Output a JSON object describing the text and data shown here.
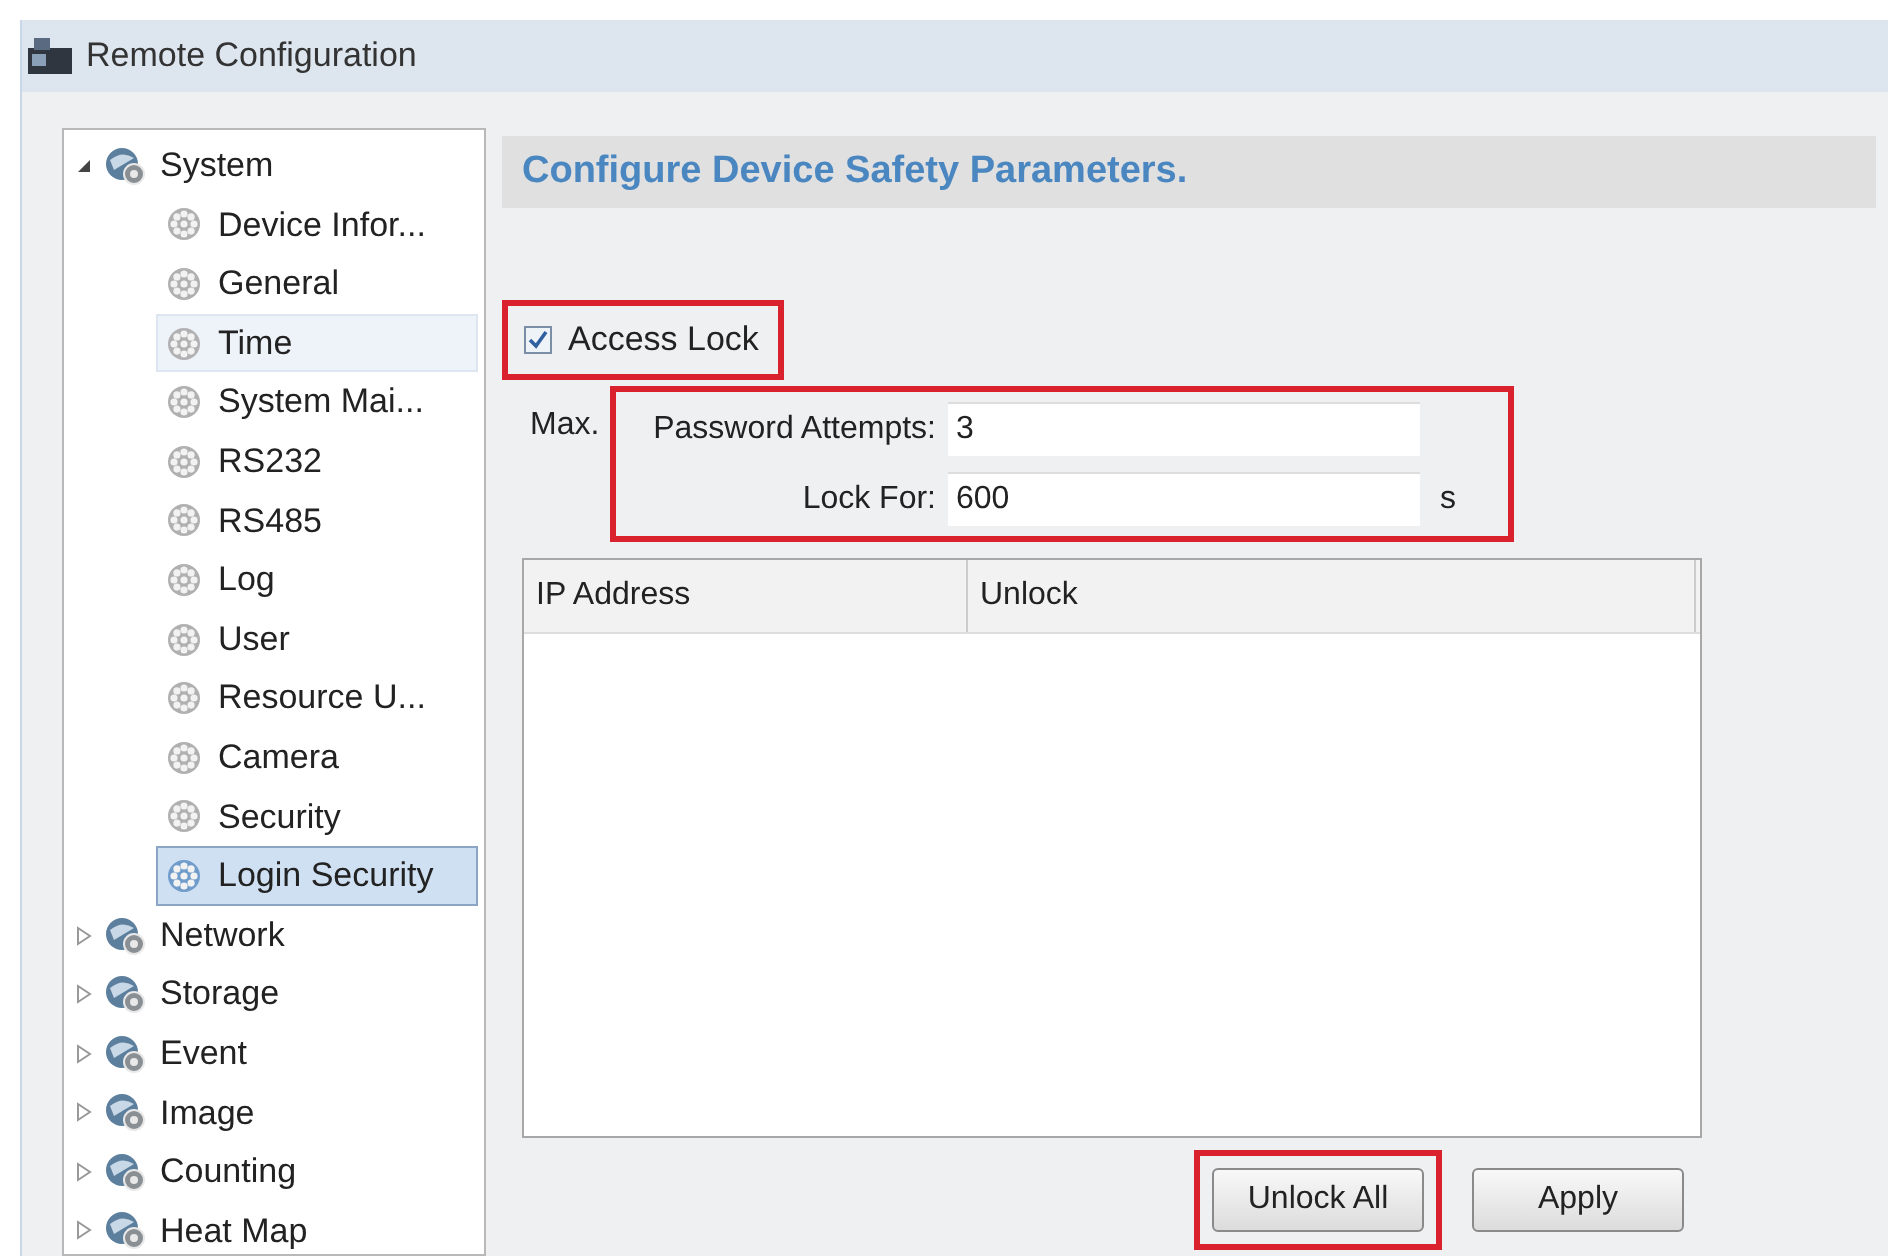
{
  "window": {
    "title": "Remote Configuration"
  },
  "tree": [
    {
      "label": "System",
      "expanded": true,
      "children": [
        {
          "label": "Device Infor...",
          "selected": false,
          "hovered": false
        },
        {
          "label": "General",
          "selected": false,
          "hovered": false
        },
        {
          "label": "Time",
          "selected": false,
          "hovered": true
        },
        {
          "label": "System Mai...",
          "selected": false,
          "hovered": false
        },
        {
          "label": "RS232",
          "selected": false,
          "hovered": false
        },
        {
          "label": "RS485",
          "selected": false,
          "hovered": false
        },
        {
          "label": "Log",
          "selected": false,
          "hovered": false
        },
        {
          "label": "User",
          "selected": false,
          "hovered": false
        },
        {
          "label": "Resource U...",
          "selected": false,
          "hovered": false
        },
        {
          "label": "Camera",
          "selected": false,
          "hovered": false
        },
        {
          "label": "Security",
          "selected": false,
          "hovered": false
        },
        {
          "label": "Login Security",
          "selected": true,
          "hovered": false
        }
      ]
    },
    {
      "label": "Network",
      "expanded": false
    },
    {
      "label": "Storage",
      "expanded": false
    },
    {
      "label": "Event",
      "expanded": false
    },
    {
      "label": "Image",
      "expanded": false
    },
    {
      "label": "Counting",
      "expanded": false
    },
    {
      "label": "Heat Map",
      "expanded": false
    }
  ],
  "panel": {
    "title": "Configure Device Safety Parameters.",
    "access_lock": {
      "label": "Access Lock",
      "checked": true,
      "highlighted": true
    },
    "fields_highlighted": true,
    "fields": [
      {
        "prefix": "Max.",
        "label": "Password Attempts:",
        "value": "3"
      },
      {
        "label": "Lock For:",
        "value": "600",
        "unit": "s"
      }
    ],
    "table": {
      "columns": [
        "IP Address",
        "Unlock"
      ]
    },
    "buttons": [
      {
        "label": "Unlock All",
        "highlighted": true
      },
      {
        "label": "Apply",
        "highlighted": false
      }
    ]
  }
}
